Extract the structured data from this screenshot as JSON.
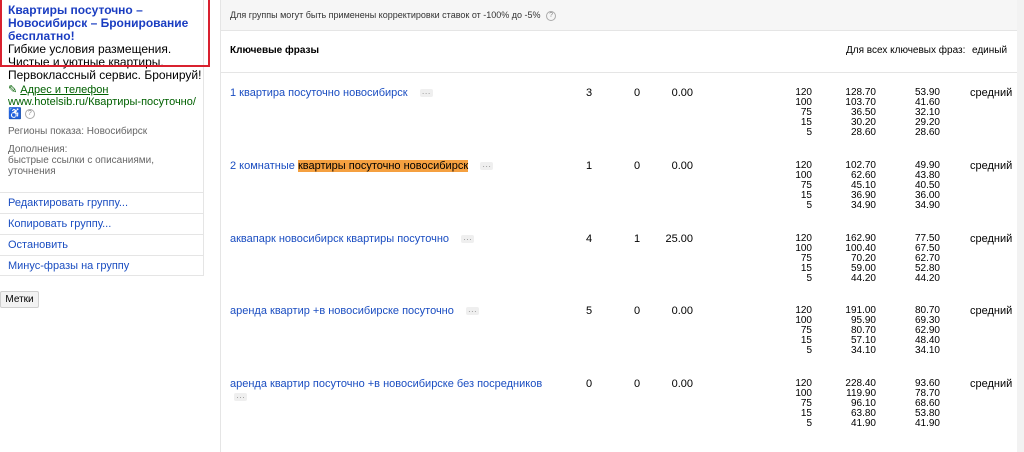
{
  "ad": {
    "title": "Квартиры посуточно – Новосибирск – Бронирование бесплатно!",
    "text": "Гибкие условия размещения. Чистые и уютные квартиры. Первоклассный сервис. Бронируй!",
    "contacts_link": "Адрес и телефон",
    "url": "www.hotelsib.ru/Квартиры-посуточно/",
    "regions": "Регионы показа: Новосибирск",
    "addons_label": "Дополнения:",
    "addons_text": "быстрые ссылки с описаниями, уточнения"
  },
  "actions": [
    "Редактировать группу...",
    "Копировать группу...",
    "Остановить",
    "Минус-фразы на группу"
  ],
  "tags_button": "Метки",
  "notice": "Для группы могут быть применены корректировки ставок от -100% до -5%",
  "header": {
    "keywords": "Ключевые фразы",
    "all_keywords": "Для всех ключевых фраз:",
    "mode": "единый"
  },
  "rows": [
    {
      "keyword_pre": "1 квартира посуточно новосибирск",
      "keyword_hl": "",
      "c1": "3",
      "c2": "0",
      "c3": "0.00",
      "volumes": "120\n100\n75\n15\n5",
      "price_a": "128.70\n103.70\n36.50\n30.20\n28.60",
      "price_b": "53.90\n41.60\n32.10\n29.20\n28.60",
      "level": "средний"
    },
    {
      "keyword_pre": "2 комнатные",
      "keyword_hl": "квартиры посуточно новосибирск",
      "c1": "1",
      "c2": "0",
      "c3": "0.00",
      "volumes": "120\n100\n75\n15\n5",
      "price_a": "102.70\n62.60\n45.10\n36.90\n34.90",
      "price_b": "49.90\n43.80\n40.50\n36.00\n34.90",
      "level": "средний"
    },
    {
      "keyword_pre": "аквапарк новосибирск квартиры посуточно",
      "keyword_hl": "",
      "c1": "4",
      "c2": "1",
      "c3": "25.00",
      "volumes": "120\n100\n75\n15\n5",
      "price_a": "162.90\n100.40\n70.20\n59.00\n44.20",
      "price_b": "77.50\n67.50\n62.70\n52.80\n44.20",
      "level": "средний"
    },
    {
      "keyword_pre": "аренда квартир +в новосибирске посуточно",
      "keyword_hl": "",
      "c1": "5",
      "c2": "0",
      "c3": "0.00",
      "volumes": "120\n100\n75\n15\n5",
      "price_a": "191.00\n95.90\n80.70\n57.10\n34.10",
      "price_b": "80.70\n69.30\n62.90\n48.40\n34.10",
      "level": "средний"
    },
    {
      "keyword_pre": "аренда квартир посуточно +в новосибирске без посредников",
      "keyword_hl": "",
      "c1": "0",
      "c2": "0",
      "c3": "0.00",
      "volumes": "120\n100\n75\n15\n5",
      "price_a": "228.40\n119.90\n96.10\n63.80\n41.90",
      "price_b": "93.60\n78.70\n68.60\n53.80\n41.90",
      "level": "средний"
    }
  ]
}
